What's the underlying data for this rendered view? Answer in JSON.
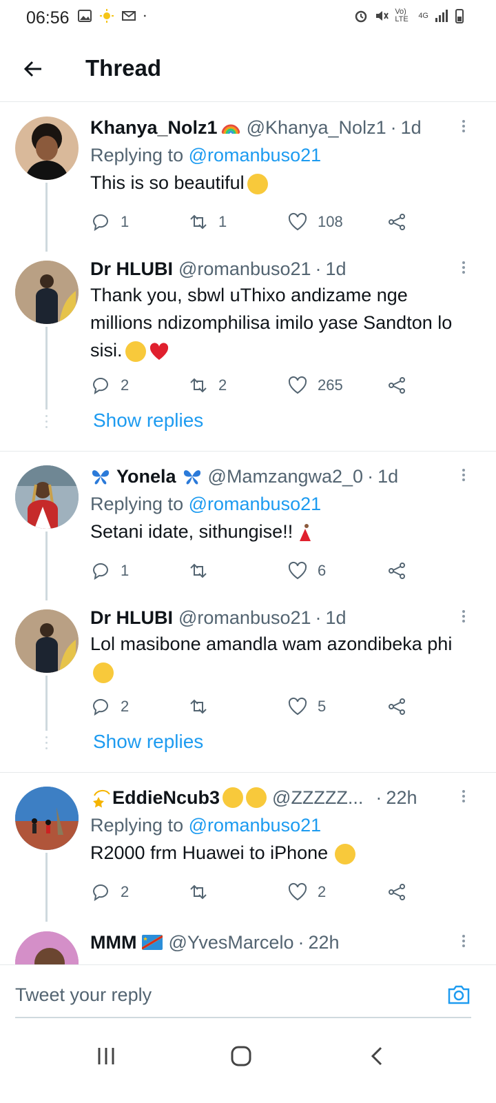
{
  "status_bar": {
    "time": "06:56",
    "network_label": "Vo) LTE",
    "network_type": "4G"
  },
  "app_bar": {
    "title": "Thread"
  },
  "tweets": [
    {
      "name": "Khanya_Nolz1",
      "handle": "@Khanya_Nolz1",
      "time": "1d",
      "replying_prefix": "Replying to ",
      "replying_to": "@romanbuso21",
      "text": "This is so beautiful",
      "replies": "1",
      "retweets": "1",
      "likes": "108",
      "avatar_color": "#d9b99a"
    },
    {
      "name": "Dr HLUBI",
      "handle": "@romanbuso21",
      "time": "1d",
      "text": "Thank you, sbwl uThixo andizame nge millions ndizomphilisa imilo yase Sandton lo sisi.",
      "replies": "2",
      "retweets": "2",
      "likes": "265",
      "avatar_color": "#b48a5a",
      "show_replies": "Show replies"
    },
    {
      "name": "Yonela",
      "handle": "@Mamzangwa2_0",
      "time": "1d",
      "replying_prefix": "Replying to ",
      "replying_to": "@romanbuso21",
      "text": "Setani idate, sithungise!!",
      "replies": "1",
      "retweets": "",
      "likes": "6",
      "avatar_color": "#8aa0b0"
    },
    {
      "name": "Dr HLUBI",
      "handle": "@romanbuso21",
      "time": "1d",
      "text": "Lol masibone amandla wam azondibeka phi",
      "replies": "2",
      "retweets": "",
      "likes": "5",
      "avatar_color": "#b48a5a",
      "show_replies": "Show replies"
    },
    {
      "name": "EddieNcub3",
      "handle": "@ZZZZZ...",
      "time": "22h",
      "replying_prefix": "Replying to ",
      "replying_to": "@romanbuso21",
      "text": "R2000 frm Huawei to iPhone",
      "replies": "2",
      "retweets": "",
      "likes": "2",
      "avatar_color": "#3d7fc4"
    },
    {
      "name": "MMM",
      "handle": "@YvesMarcelo",
      "time": "22h",
      "avatar_color": "#c77dbd"
    }
  ],
  "composer": {
    "placeholder": "Tweet your reply"
  },
  "colors": {
    "accent": "#1d9bf0",
    "text": "#0f1419",
    "secondary": "#536471",
    "heart_emoji": "#e0202e"
  }
}
